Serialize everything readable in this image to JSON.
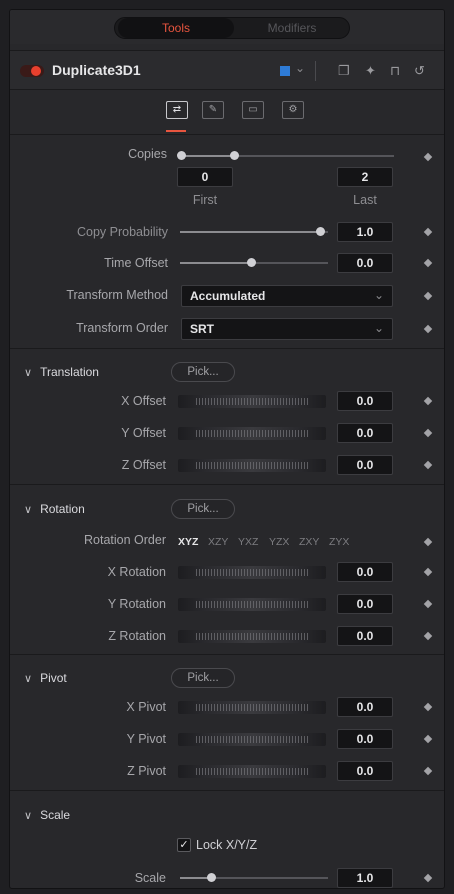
{
  "tabs": {
    "tools": "Tools",
    "modifiers": "Modifiers"
  },
  "header": {
    "tool_name": "Duplicate3D1",
    "enabled": true,
    "color_chip": "#2e7bd6",
    "icons": [
      "chevron-down-icon",
      "window-icon",
      "pin-icon",
      "lock-icon",
      "reset-icon"
    ]
  },
  "icon_tabs": [
    {
      "name": "controls-tab-icon",
      "glyph": "⇄"
    },
    {
      "name": "materials-tab-icon",
      "glyph": "✎"
    },
    {
      "name": "transform-tab-icon",
      "glyph": "▭"
    },
    {
      "name": "settings-tab-icon",
      "glyph": "⚙"
    }
  ],
  "copies": {
    "label": "Copies",
    "first_value": "0",
    "last_value": "2",
    "first_label": "First",
    "last_label": "Last"
  },
  "copy_probability": {
    "label": "Copy Probability",
    "value": "1.0"
  },
  "time_offset": {
    "label": "Time Offset",
    "value": "0.0"
  },
  "transform_method": {
    "label": "Transform Method",
    "value": "Accumulated"
  },
  "transform_order": {
    "label": "Transform Order",
    "value": "SRT"
  },
  "translation": {
    "title": "Translation",
    "pick": "Pick...",
    "x_label": "X Offset",
    "x_value": "0.0",
    "y_label": "Y Offset",
    "y_value": "0.0",
    "z_label": "Z Offset",
    "z_value": "0.0"
  },
  "rotation": {
    "title": "Rotation",
    "pick": "Pick...",
    "order_label": "Rotation Order",
    "orders": [
      "XYZ",
      "XZY",
      "YXZ",
      "YZX",
      "ZXY",
      "ZYX"
    ],
    "selected_order": "XYZ",
    "x_label": "X Rotation",
    "x_value": "0.0",
    "y_label": "Y Rotation",
    "y_value": "0.0",
    "z_label": "Z Rotation",
    "z_value": "0.0"
  },
  "pivot": {
    "title": "Pivot",
    "pick": "Pick...",
    "x_label": "X Pivot",
    "x_value": "0.0",
    "y_label": "Y Pivot",
    "y_value": "0.0",
    "z_label": "Z Pivot",
    "z_value": "0.0"
  },
  "scale": {
    "title": "Scale",
    "lock_label": "Lock X/Y/Z",
    "lock_checked": true,
    "label": "Scale",
    "value": "1.0"
  }
}
